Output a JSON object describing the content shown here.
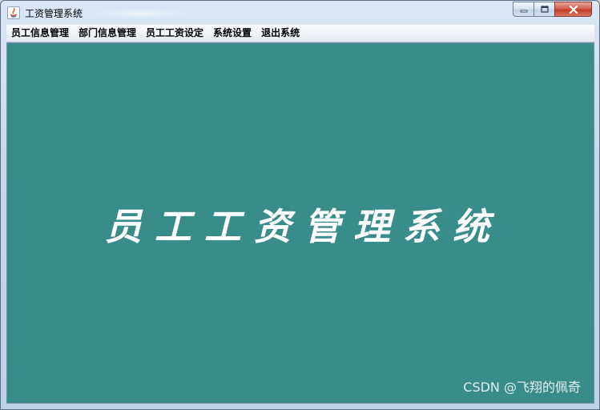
{
  "window": {
    "title": "工资管理系统",
    "controls": {
      "minimize_icon": "minimize-icon",
      "maximize_icon": "maximize-icon",
      "close_icon": "close-icon"
    }
  },
  "menubar": {
    "items": [
      {
        "label": "员工信息管理"
      },
      {
        "label": "部门信息管理"
      },
      {
        "label": "员工工资设定"
      },
      {
        "label": "系统设置"
      },
      {
        "label": "退出系统"
      }
    ]
  },
  "main": {
    "banner_text": "员工工资管理系统",
    "background_color": "#388d8b"
  },
  "watermark": {
    "text": "CSDN @飞翔的佩奇"
  }
}
